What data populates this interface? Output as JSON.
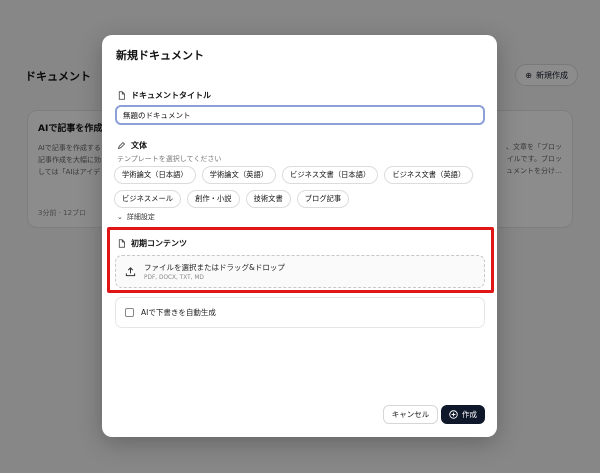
{
  "background": {
    "page_title": "ドキュメント",
    "new_button_label": "新規作成",
    "card": {
      "title": "AIで記事を作成す",
      "lines": [
        "AIで記事を作成する",
        "記事作成を大幅に効",
        "しては「AIはアイデ"
      ],
      "meta": "3分前 · 12ブロ"
    },
    "card_right_lines": [
      "、文章を「ブロッ",
      "イルです。ブロッ",
      "ュメントを分け…"
    ]
  },
  "modal": {
    "title": "新規ドキュメント",
    "doc_title_section": {
      "label": "ドキュメントタイトル",
      "value": "無題のドキュメント"
    },
    "style_section": {
      "label": "文体",
      "hint": "テンプレートを選択してください",
      "chips": [
        "学術論文（日本語）",
        "学術論文（英語）",
        "ビジネス文書（日本語）",
        "ビジネス文書（英語）",
        "ビジネスメール",
        "創作・小説",
        "技術文書",
        "ブログ記事"
      ]
    },
    "advanced_label": "詳細設定",
    "initial_content": {
      "label": "初期コンテンツ",
      "dropzone_text": "ファイルを選択またはドラッグ&ドロップ",
      "dropzone_formats": "PDF, DOCX, TXT, MD"
    },
    "ai_draft_label": "AIで下書きを自動生成",
    "cancel_label": "キャンセル",
    "create_label": "作成"
  },
  "colors": {
    "highlight": "#e01616",
    "primary_button": "#0f172a",
    "focus_border": "#8aa0d6"
  }
}
